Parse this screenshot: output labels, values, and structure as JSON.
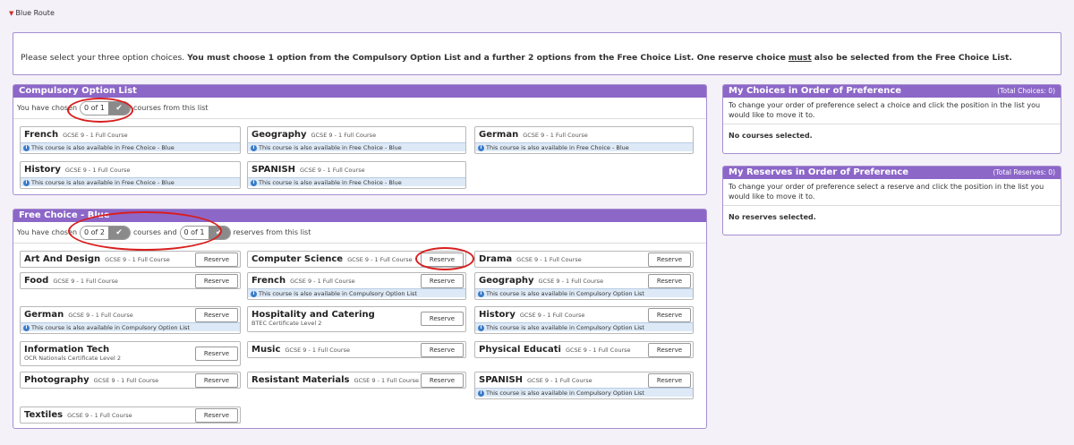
{
  "section": {
    "label": "Blue Route"
  },
  "instructions": {
    "plain": "Please select your three option choices.",
    "bold_a": "You must choose 1 option from the Compulsory Option List and a further 2 options from the Free Choice List.  One reserve choice",
    "underlined": "must",
    "bold_b": "also be selected from the Free Choice List."
  },
  "compulsory": {
    "title": "Compulsory Option List",
    "count_prefix": "You have chosen",
    "counter": "0 of 1",
    "count_suffix": "courses from this list",
    "courses": [
      {
        "title": "French",
        "meta": "GCSE 9 - 1 Full Course",
        "info": "This course is also available in Free Choice - Blue"
      },
      {
        "title": "Geography",
        "meta": "GCSE 9 - 1 Full Course",
        "info": "This course is also available in Free Choice - Blue"
      },
      {
        "title": "German",
        "meta": "GCSE 9 - 1 Full Course",
        "info": "This course is also available in Free Choice - Blue"
      },
      {
        "title": "History",
        "meta": "GCSE 9 - 1 Full Course",
        "info": "This course is also available in Free Choice - Blue"
      },
      {
        "title": "SPANISH",
        "meta": "GCSE 9 - 1 Full Course",
        "info": "This course is also available in Free Choice - Blue"
      }
    ]
  },
  "free": {
    "title": "Free Choice - Blue",
    "count_prefix": "You have chosen",
    "counter_courses": "0 of 2",
    "count_middle": "courses and",
    "counter_reserves": "0 of 1",
    "count_suffix": "reserves from this list",
    "reserve_label": "Reserve",
    "courses": [
      {
        "title": "Art And Design",
        "meta": "GCSE 9 - 1 Full Course"
      },
      {
        "title": "Computer Science",
        "meta": "GCSE 9 - 1 Full Course"
      },
      {
        "title": "Drama",
        "meta": "GCSE 9 - 1 Full Course"
      },
      {
        "title": "Food",
        "meta": "GCSE 9 - 1 Full Course"
      },
      {
        "title": "French",
        "meta": "GCSE 9 - 1 Full Course",
        "info": "This course is also available in Compulsory Option List"
      },
      {
        "title": "Geography",
        "meta": "GCSE 9 - 1 Full Course",
        "info": "This course is also available in Compulsory Option List"
      },
      {
        "title": "German",
        "meta": "GCSE 9 - 1 Full Course",
        "info": "This course is also available in Compulsory Option List"
      },
      {
        "title": "Hospitality and Catering",
        "sub": "BTEC Certificate Level 2"
      },
      {
        "title": "History",
        "meta": "GCSE 9 - 1 Full Course",
        "info": "This course is also available in Compulsory Option List"
      },
      {
        "title": "Information Tech",
        "sub": "OCR Nationals Certificate Level 2"
      },
      {
        "title": "Music",
        "meta": "GCSE 9 - 1 Full Course"
      },
      {
        "title": "Physical Educati",
        "meta": "GCSE 9 - 1 Full Course"
      },
      {
        "title": "Photography",
        "meta": "GCSE 9 - 1 Full Course"
      },
      {
        "title": "Resistant Materials",
        "meta": "GCSE 9 - 1 Full Course"
      },
      {
        "title": "SPANISH",
        "meta": "GCSE 9 - 1 Full Course",
        "info": "This course is also available in Compulsory Option List"
      },
      {
        "title": "Textiles",
        "meta": "GCSE 9 - 1 Full Course"
      }
    ]
  },
  "choices": {
    "title": "My Choices in Order of Preference",
    "total": "(Total Choices: 0)",
    "text": "To change your order of preference select a choice and click the position in the list you would like to move it to.",
    "empty": "No courses selected."
  },
  "reserves": {
    "title": "My Reserves in Order of Preference",
    "total": "(Total Reserves: 0)",
    "text": "To change your order of preference select a reserve and click the position in the list you would like to move it to.",
    "empty": "No reserves selected."
  },
  "colors": {
    "header": "#8c67c8",
    "border": "#a68ed0",
    "highlight": "#d81e1e",
    "info_bg": "#dde9f6"
  }
}
